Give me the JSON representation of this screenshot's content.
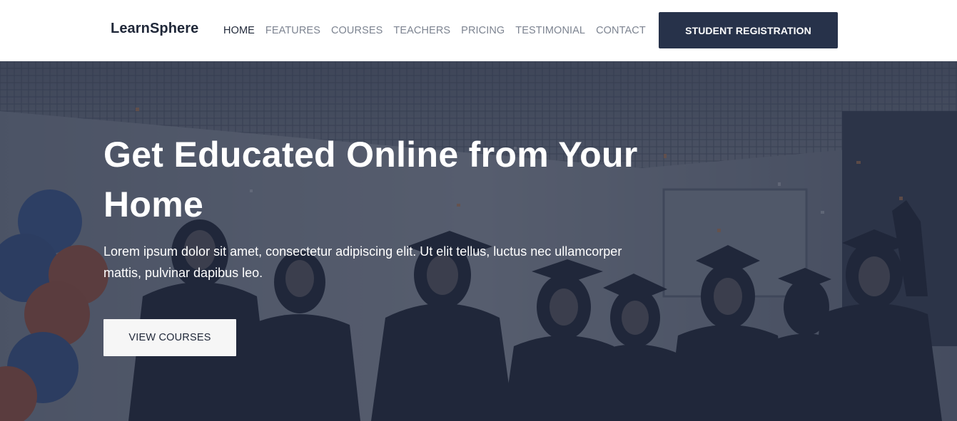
{
  "header": {
    "logo": "LearnSphere",
    "nav": [
      {
        "label": "HOME",
        "active": true
      },
      {
        "label": "FEATURES",
        "active": false
      },
      {
        "label": "COURSES",
        "active": false
      },
      {
        "label": "TEACHERS",
        "active": false
      },
      {
        "label": "PRICING",
        "active": false
      },
      {
        "label": "TESTIMONIAL",
        "active": false
      },
      {
        "label": "CONTACT",
        "active": false
      }
    ],
    "register_button": "STUDENT REGISTRATION"
  },
  "hero": {
    "title": "Get Educated Online from Your Home",
    "text": "Lorem ipsum dolor sit amet, consectetur adipiscing elit. Ut elit tellus, luctus nec ullamcorper mattis, pulvinar dapibus leo.",
    "cta_button": "VIEW COURSES",
    "background_image": "graduation-celebration-photo"
  },
  "colors": {
    "brand_dark": "#27324a",
    "nav_active": "#1f2738",
    "nav_inactive": "#7d8491",
    "hero_overlay": "#242c40"
  }
}
